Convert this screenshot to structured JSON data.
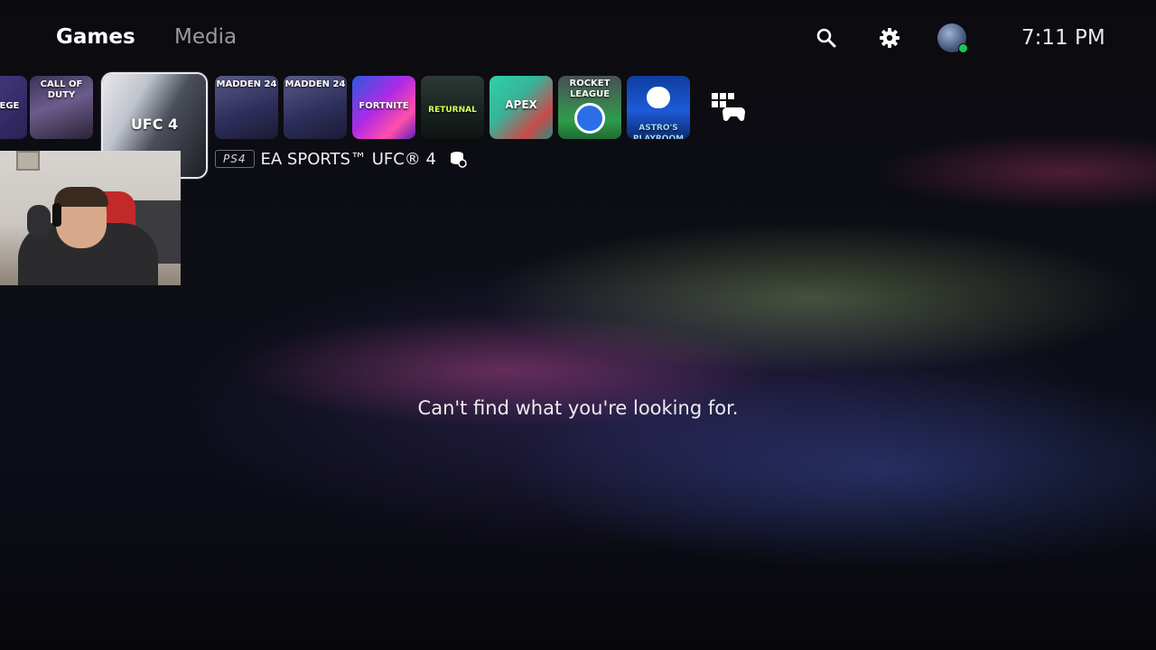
{
  "nav": {
    "tabs": [
      "Games",
      "Media"
    ]
  },
  "header": {
    "clock": "7:11 PM"
  },
  "games_row": {
    "tiles": [
      {
        "name": "siege",
        "caption": "SIEGE"
      },
      {
        "name": "call-of-duty",
        "caption": "CALL OF DUTY"
      },
      {
        "name": "ufc-4",
        "caption": "UFC 4"
      },
      {
        "name": "madden-24-a",
        "caption": "MADDEN 24"
      },
      {
        "name": "madden-24-b",
        "caption": "MADDEN 24"
      },
      {
        "name": "fortnite",
        "caption": "FORTNITE"
      },
      {
        "name": "returnal",
        "caption": "RETURNAL"
      },
      {
        "name": "apex",
        "caption": "APEX"
      },
      {
        "name": "rocket-league",
        "caption": "ROCKET LEAGUE"
      },
      {
        "name": "astro-playroom",
        "caption": "ASTRO'S PLAYROOM"
      }
    ]
  },
  "selected_game": {
    "platform": "PS4",
    "title": "EA SPORTS™ UFC® 4"
  },
  "main": {
    "message": "Can't find what you're looking for."
  },
  "colors": {
    "online": "#21c45a",
    "selection": "#e8e8ee",
    "inactive_tab": "#9a9aa0"
  }
}
